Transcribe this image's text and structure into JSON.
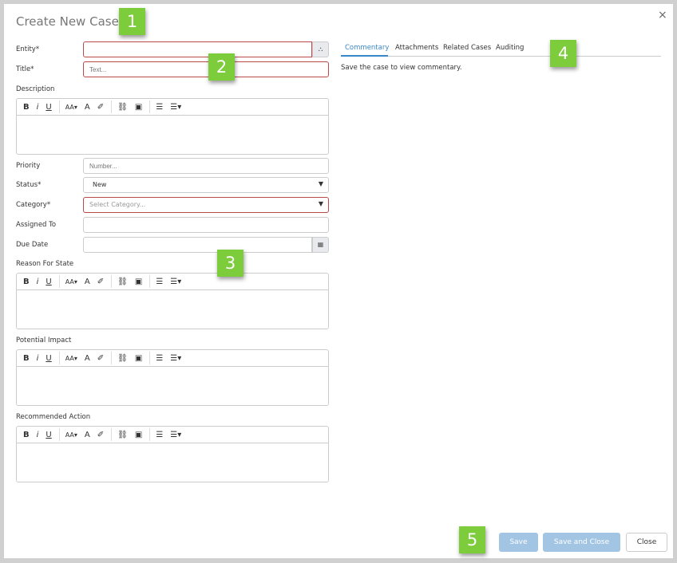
{
  "dialog": {
    "title": "Create New Case",
    "close_icon": "×"
  },
  "fields": {
    "entity": {
      "label": "Entity*",
      "value": ""
    },
    "title": {
      "label": "Title*",
      "placeholder": "Text..."
    },
    "description": {
      "label": "Description"
    },
    "priority": {
      "label": "Priority",
      "placeholder": "Number..."
    },
    "status": {
      "label": "Status*",
      "value": "New"
    },
    "category": {
      "label": "Category*",
      "placeholder": "Select Category..."
    },
    "assigned_to": {
      "label": "Assigned To",
      "value": ""
    },
    "due_date": {
      "label": "Due Date",
      "value": ""
    },
    "reason_for_state": {
      "label": "Reason For State"
    },
    "potential_impact": {
      "label": "Potential Impact"
    },
    "recommended_action": {
      "label": "Recommended Action"
    }
  },
  "toolbar": {
    "bold": "B",
    "italic": "i",
    "underline": "U",
    "font_size": "AA▾",
    "font_color": "A",
    "highlight": "✐",
    "link": "⛓",
    "image": "▣",
    "ordered_list": "☰",
    "unordered_list": "☰▾"
  },
  "tabs": [
    {
      "label": "Commentary",
      "active": true
    },
    {
      "label": "Attachments"
    },
    {
      "label": "Related Cases"
    },
    {
      "label": "Auditing"
    }
  ],
  "commentary_message": "Save the case to view commentary.",
  "badges": [
    "1",
    "2",
    "3",
    "4",
    "5"
  ],
  "buttons": {
    "save": "Save",
    "save_and_close": "Save and Close",
    "close": "Close"
  },
  "colors": {
    "accent": "#3a87c8",
    "required_border": "#b94a48",
    "badge": "#7dcc3c",
    "disabled_button": "#a3c5e4"
  }
}
